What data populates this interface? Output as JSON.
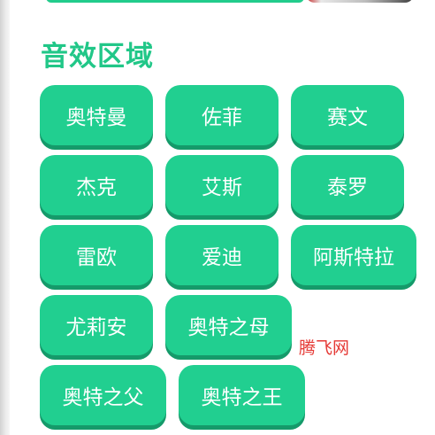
{
  "section": {
    "title": "音效区域"
  },
  "buttons": [
    {
      "label": "奥特曼"
    },
    {
      "label": "佐菲"
    },
    {
      "label": "赛文"
    },
    {
      "label": "杰克"
    },
    {
      "label": "艾斯"
    },
    {
      "label": "泰罗"
    },
    {
      "label": "雷欧"
    },
    {
      "label": "爱迪"
    },
    {
      "label": "阿斯特拉"
    },
    {
      "label": "尤莉安"
    },
    {
      "label": "奥特之母"
    },
    {
      "label": "奥特之父"
    },
    {
      "label": "奥特之王"
    }
  ],
  "watermark": "腾飞网",
  "colors": {
    "accent": "#21CF90",
    "button_shadow": "#159A6A",
    "watermark": "#E53935"
  }
}
